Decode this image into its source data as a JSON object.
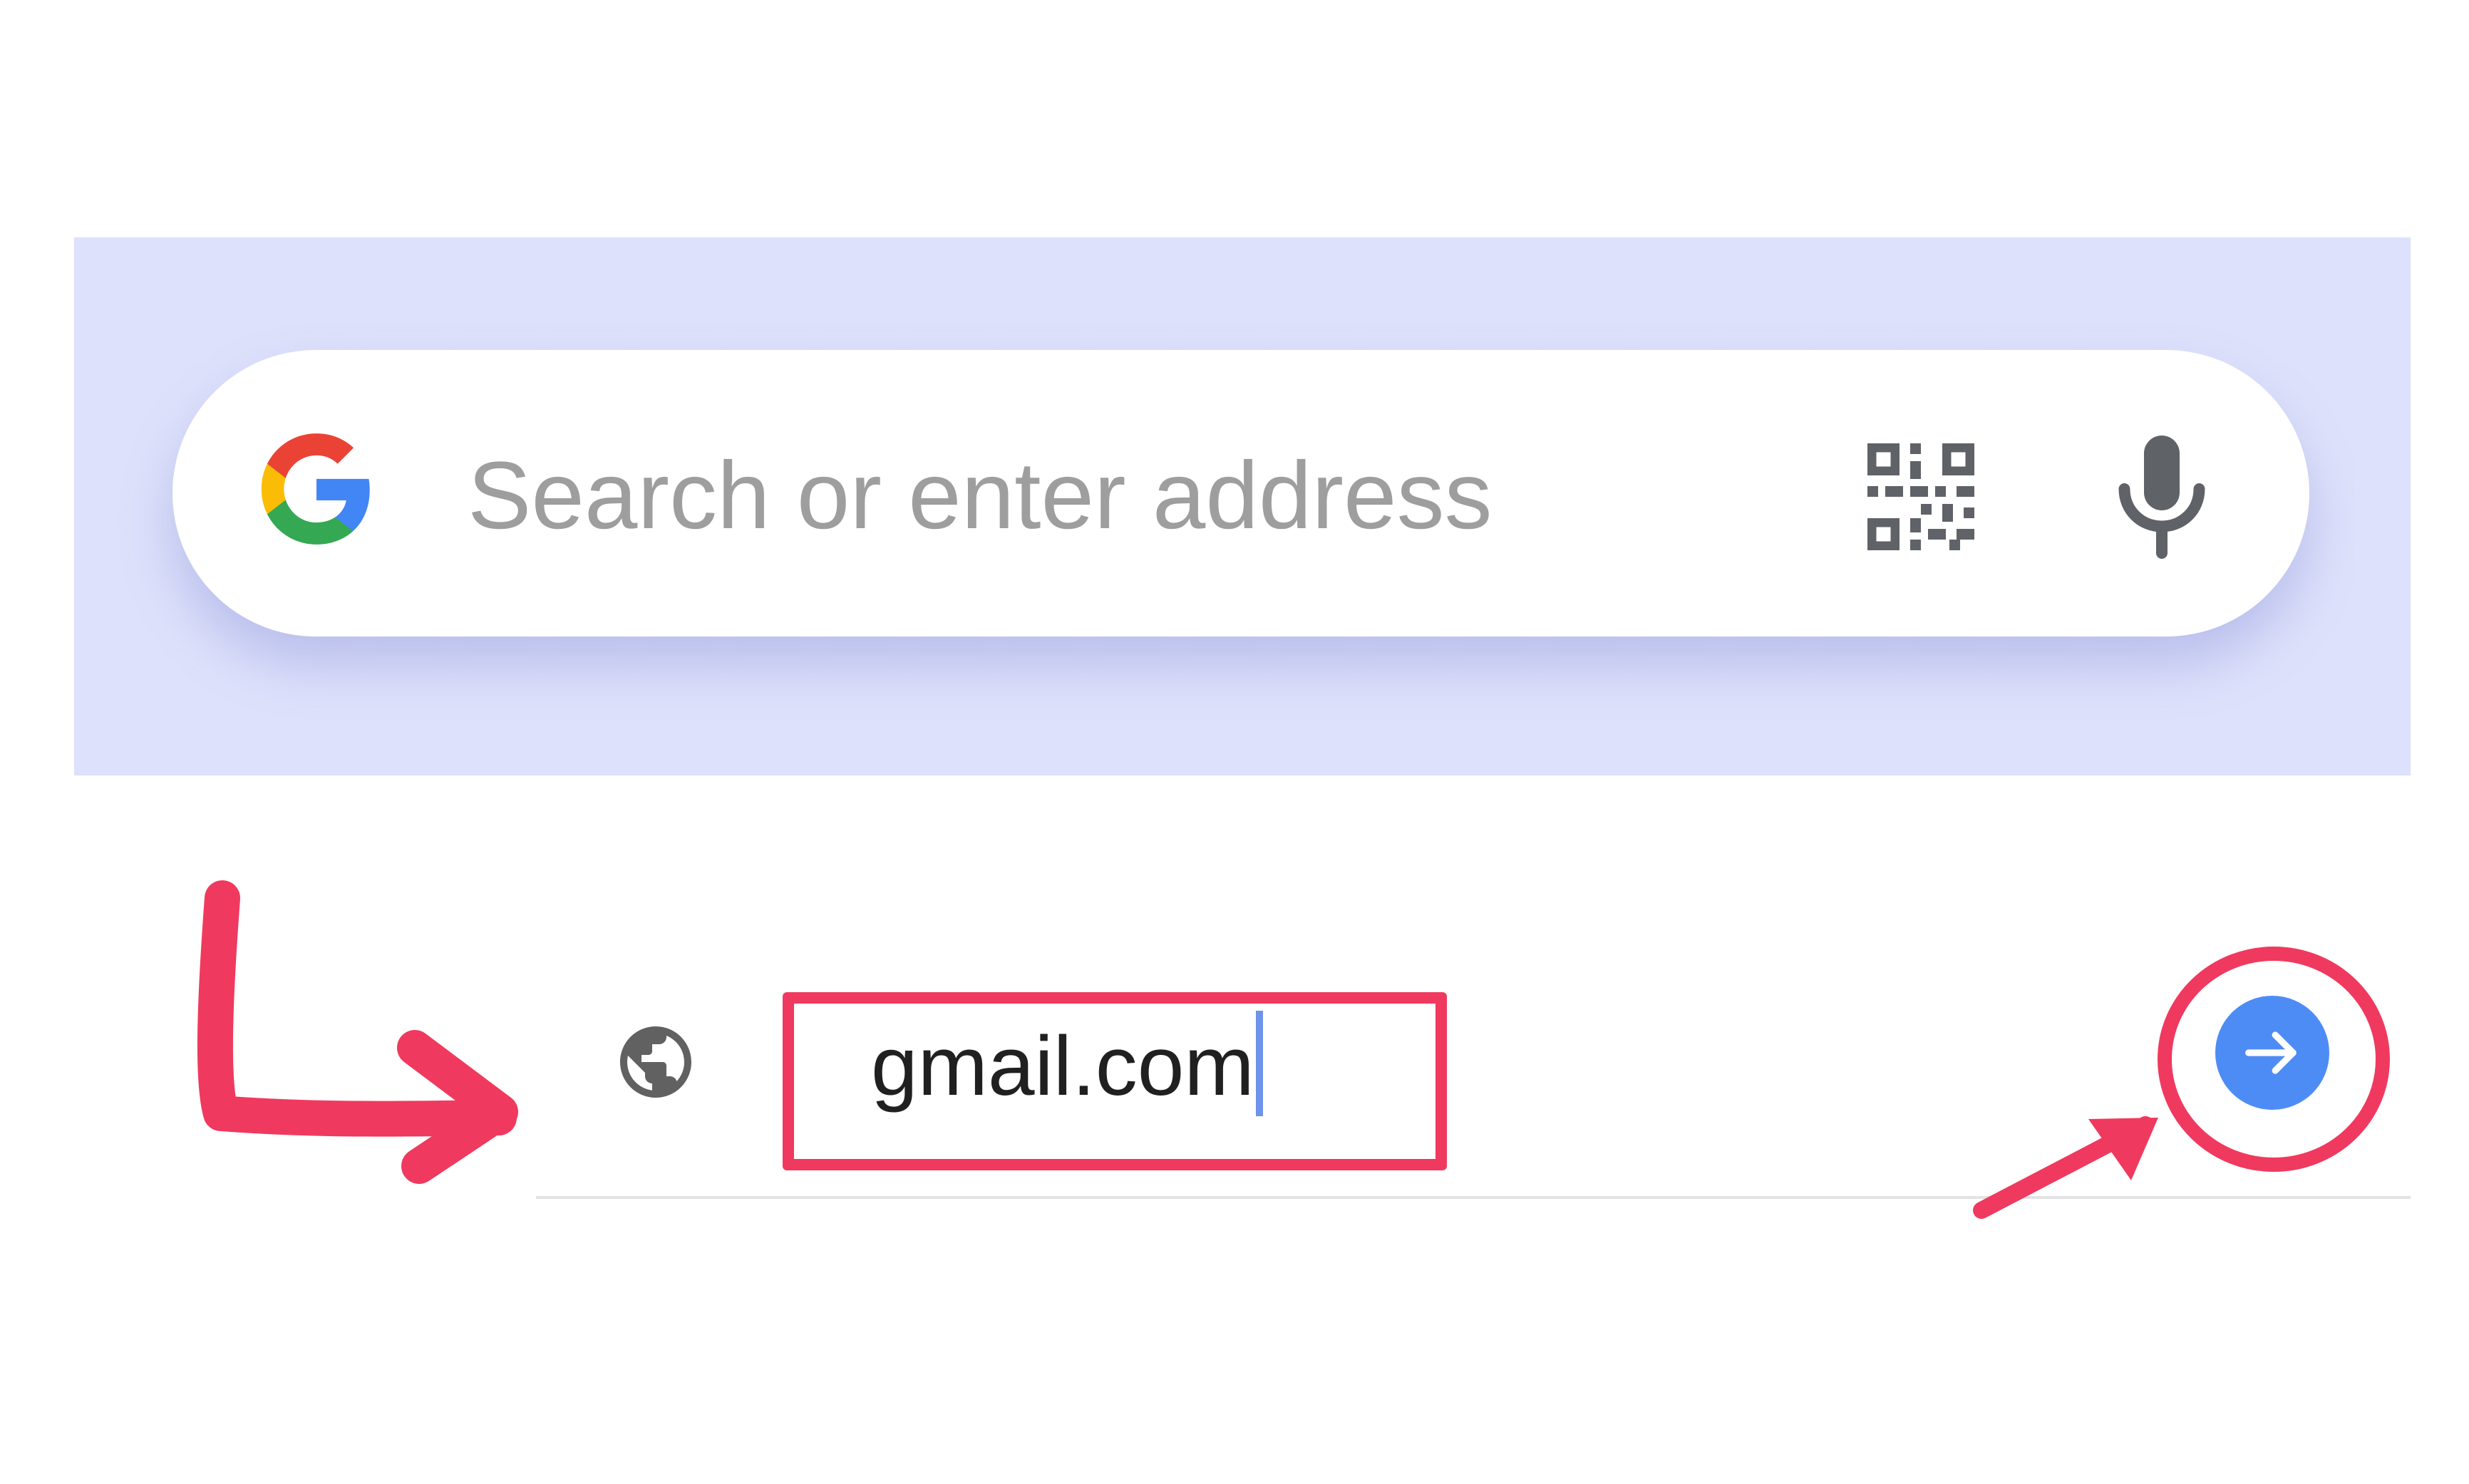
{
  "search_bar": {
    "placeholder": "Search or enter address",
    "logo_icon": "google-g-icon",
    "qr_icon": "qr-code-scan-icon",
    "mic_icon": "microphone-icon"
  },
  "suggestion": {
    "icon": "globe-icon",
    "url": "gmail.com",
    "go_icon": "arrow-right-icon"
  },
  "colors": {
    "top_panel_bg": "#dde1fb",
    "go_button": "#4e8cf5",
    "annotation": "#f0395e",
    "placeholder_text": "#9e9e9e"
  }
}
